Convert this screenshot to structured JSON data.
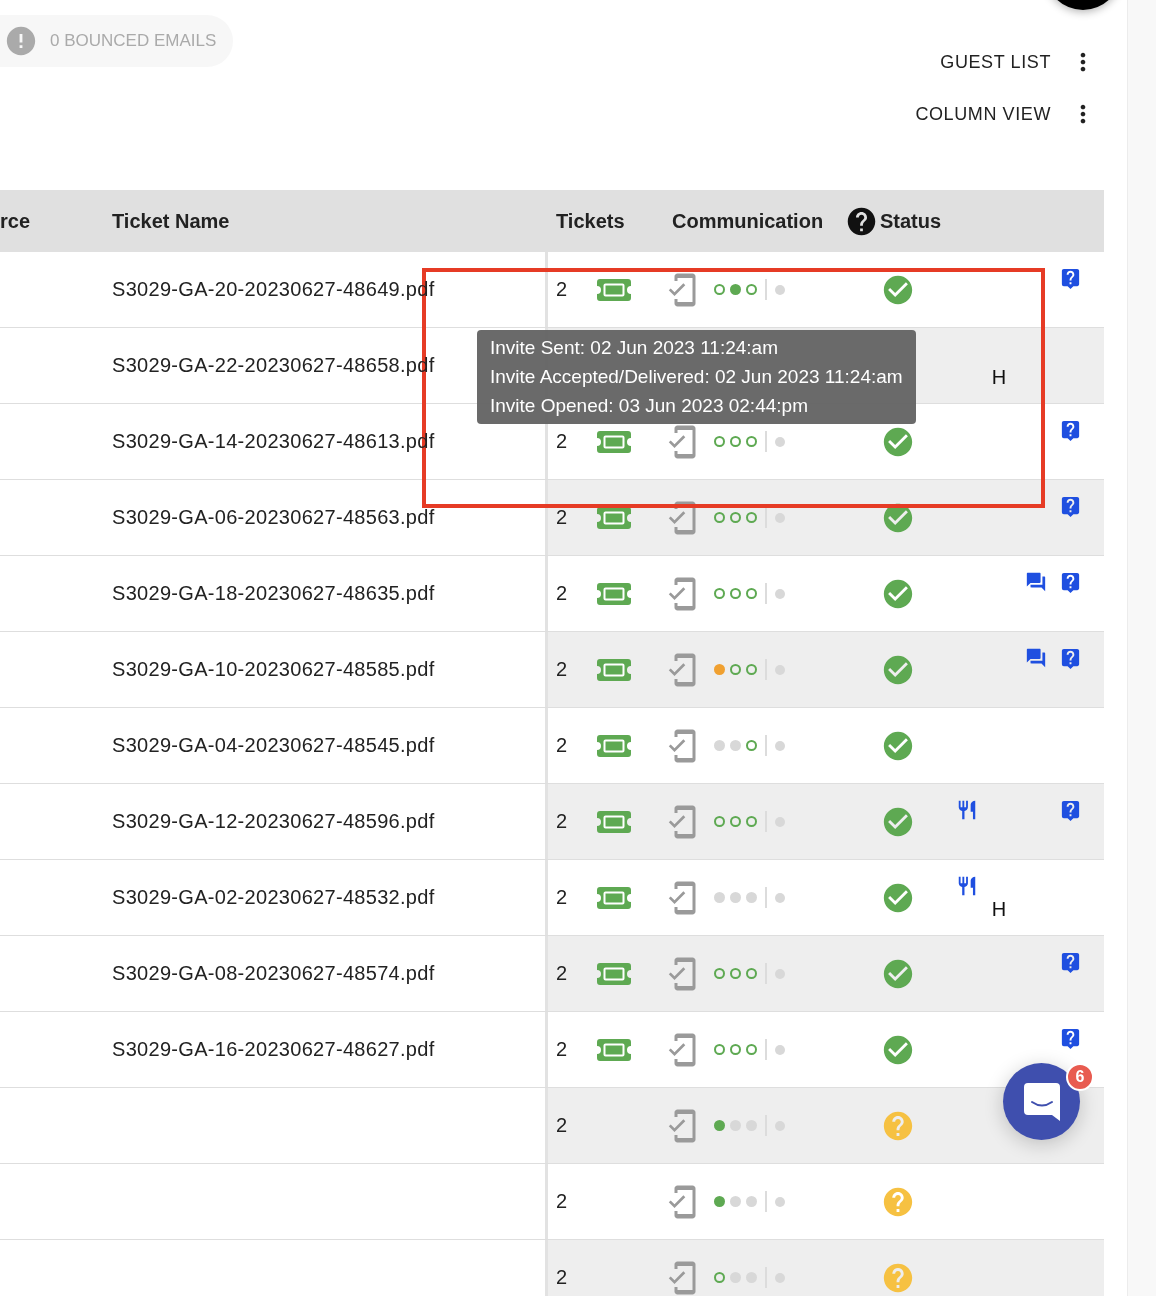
{
  "bounced": {
    "label": "0 BOUNCED EMAILS"
  },
  "menus": [
    {
      "label": "GUEST LIST"
    },
    {
      "label": "COLUMN VIEW"
    }
  ],
  "table": {
    "columns": [
      {
        "label": "rce"
      },
      {
        "label": "Ticket Name"
      },
      {
        "label": "Tickets"
      },
      {
        "label": "Communication"
      },
      {
        "label": "Status"
      }
    ],
    "rows": [
      {
        "ticket_name": "S3029-GA-20-20230627-48649.pdf",
        "tickets": "2",
        "has_ticket": true,
        "dots": [
          {
            "color": "#5ea952",
            "filled": false
          },
          {
            "color": "#5ea952",
            "filled": true
          },
          {
            "color": "#5ea952",
            "filled": false
          }
        ],
        "confirmed": true,
        "question": true
      },
      {
        "ticket_name": "S3029-GA-22-20230627-48658.pdf",
        "hotel": "H"
      },
      {
        "ticket_name": "S3029-GA-14-20230627-48613.pdf",
        "tickets": "2",
        "has_ticket": true,
        "dots": [
          {
            "color": "#5ea952",
            "filled": false
          },
          {
            "color": "#5ea952",
            "filled": false
          },
          {
            "color": "#5ea952",
            "filled": false
          }
        ],
        "confirmed": true,
        "question": true
      },
      {
        "ticket_name": "S3029-GA-06-20230627-48563.pdf",
        "tickets": "2",
        "has_ticket": true,
        "dots": [
          {
            "color": "#5ea952",
            "filled": false
          },
          {
            "color": "#5ea952",
            "filled": false
          },
          {
            "color": "#5ea952",
            "filled": false
          }
        ],
        "confirmed": true,
        "question": true
      },
      {
        "ticket_name": "S3029-GA-18-20230627-48635.pdf",
        "tickets": "2",
        "has_ticket": true,
        "dots": [
          {
            "color": "#5ea952",
            "filled": false
          },
          {
            "color": "#5ea952",
            "filled": false
          },
          {
            "color": "#5ea952",
            "filled": false
          }
        ],
        "confirmed": true,
        "chat": true,
        "question": true
      },
      {
        "ticket_name": "S3029-GA-10-20230627-48585.pdf",
        "tickets": "2",
        "has_ticket": true,
        "dots": [
          {
            "color": "#f0a030",
            "filled": true
          },
          {
            "color": "#5ea952",
            "filled": false
          },
          {
            "color": "#5ea952",
            "filled": false
          }
        ],
        "confirmed": true,
        "chat": true,
        "question": true
      },
      {
        "ticket_name": "S3029-GA-04-20230627-48545.pdf",
        "tickets": "2",
        "has_ticket": true,
        "dots": [
          {
            "color": "#d8d8d8",
            "filled": true
          },
          {
            "color": "#d8d8d8",
            "filled": true
          },
          {
            "color": "#5ea952",
            "filled": false
          }
        ],
        "confirmed": true
      },
      {
        "ticket_name": "S3029-GA-12-20230627-48596.pdf",
        "tickets": "2",
        "has_ticket": true,
        "dots": [
          {
            "color": "#5ea952",
            "filled": false
          },
          {
            "color": "#5ea952",
            "filled": false
          },
          {
            "color": "#5ea952",
            "filled": false
          }
        ],
        "confirmed": true,
        "meal": true,
        "question": true
      },
      {
        "ticket_name": "S3029-GA-02-20230627-48532.pdf",
        "tickets": "2",
        "has_ticket": true,
        "dots": [
          {
            "color": "#d8d8d8",
            "filled": true
          },
          {
            "color": "#d8d8d8",
            "filled": true
          },
          {
            "color": "#d8d8d8",
            "filled": true
          }
        ],
        "confirmed": true,
        "meal": true,
        "hotel": "H"
      },
      {
        "ticket_name": "S3029-GA-08-20230627-48574.pdf",
        "tickets": "2",
        "has_ticket": true,
        "dots": [
          {
            "color": "#5ea952",
            "filled": false
          },
          {
            "color": "#5ea952",
            "filled": false
          },
          {
            "color": "#5ea952",
            "filled": false
          }
        ],
        "confirmed": true,
        "question": true
      },
      {
        "ticket_name": "S3029-GA-16-20230627-48627.pdf",
        "tickets": "2",
        "has_ticket": true,
        "dots": [
          {
            "color": "#5ea952",
            "filled": false
          },
          {
            "color": "#5ea952",
            "filled": false
          },
          {
            "color": "#5ea952",
            "filled": false
          }
        ],
        "confirmed": true,
        "question": true
      },
      {
        "tickets": "2",
        "has_ticket": false,
        "dots": [
          {
            "color": "#5ea952",
            "filled": true
          },
          {
            "color": "#d8d8d8",
            "filled": true
          },
          {
            "color": "#d8d8d8",
            "filled": true
          }
        ],
        "confirmed": false
      },
      {
        "tickets": "2",
        "has_ticket": false,
        "dots": [
          {
            "color": "#5ea952",
            "filled": true
          },
          {
            "color": "#d8d8d8",
            "filled": true
          },
          {
            "color": "#d8d8d8",
            "filled": true
          }
        ],
        "confirmed": false
      },
      {
        "tickets": "2",
        "has_ticket": false,
        "dots": [
          {
            "color": "#5ea952",
            "filled": false
          },
          {
            "color": "#d8d8d8",
            "filled": true
          },
          {
            "color": "#d8d8d8",
            "filled": true
          }
        ],
        "confirmed": false
      }
    ]
  },
  "tooltip": {
    "lines": [
      "Invite Sent: 02 Jun 2023 11:24:am",
      "Invite Accepted/Delivered: 02 Jun 2023 11:24:am",
      "Invite Opened: 03 Jun 2023 02:44:pm"
    ]
  },
  "highlight": true,
  "chat_launcher": {
    "badge": "6"
  }
}
